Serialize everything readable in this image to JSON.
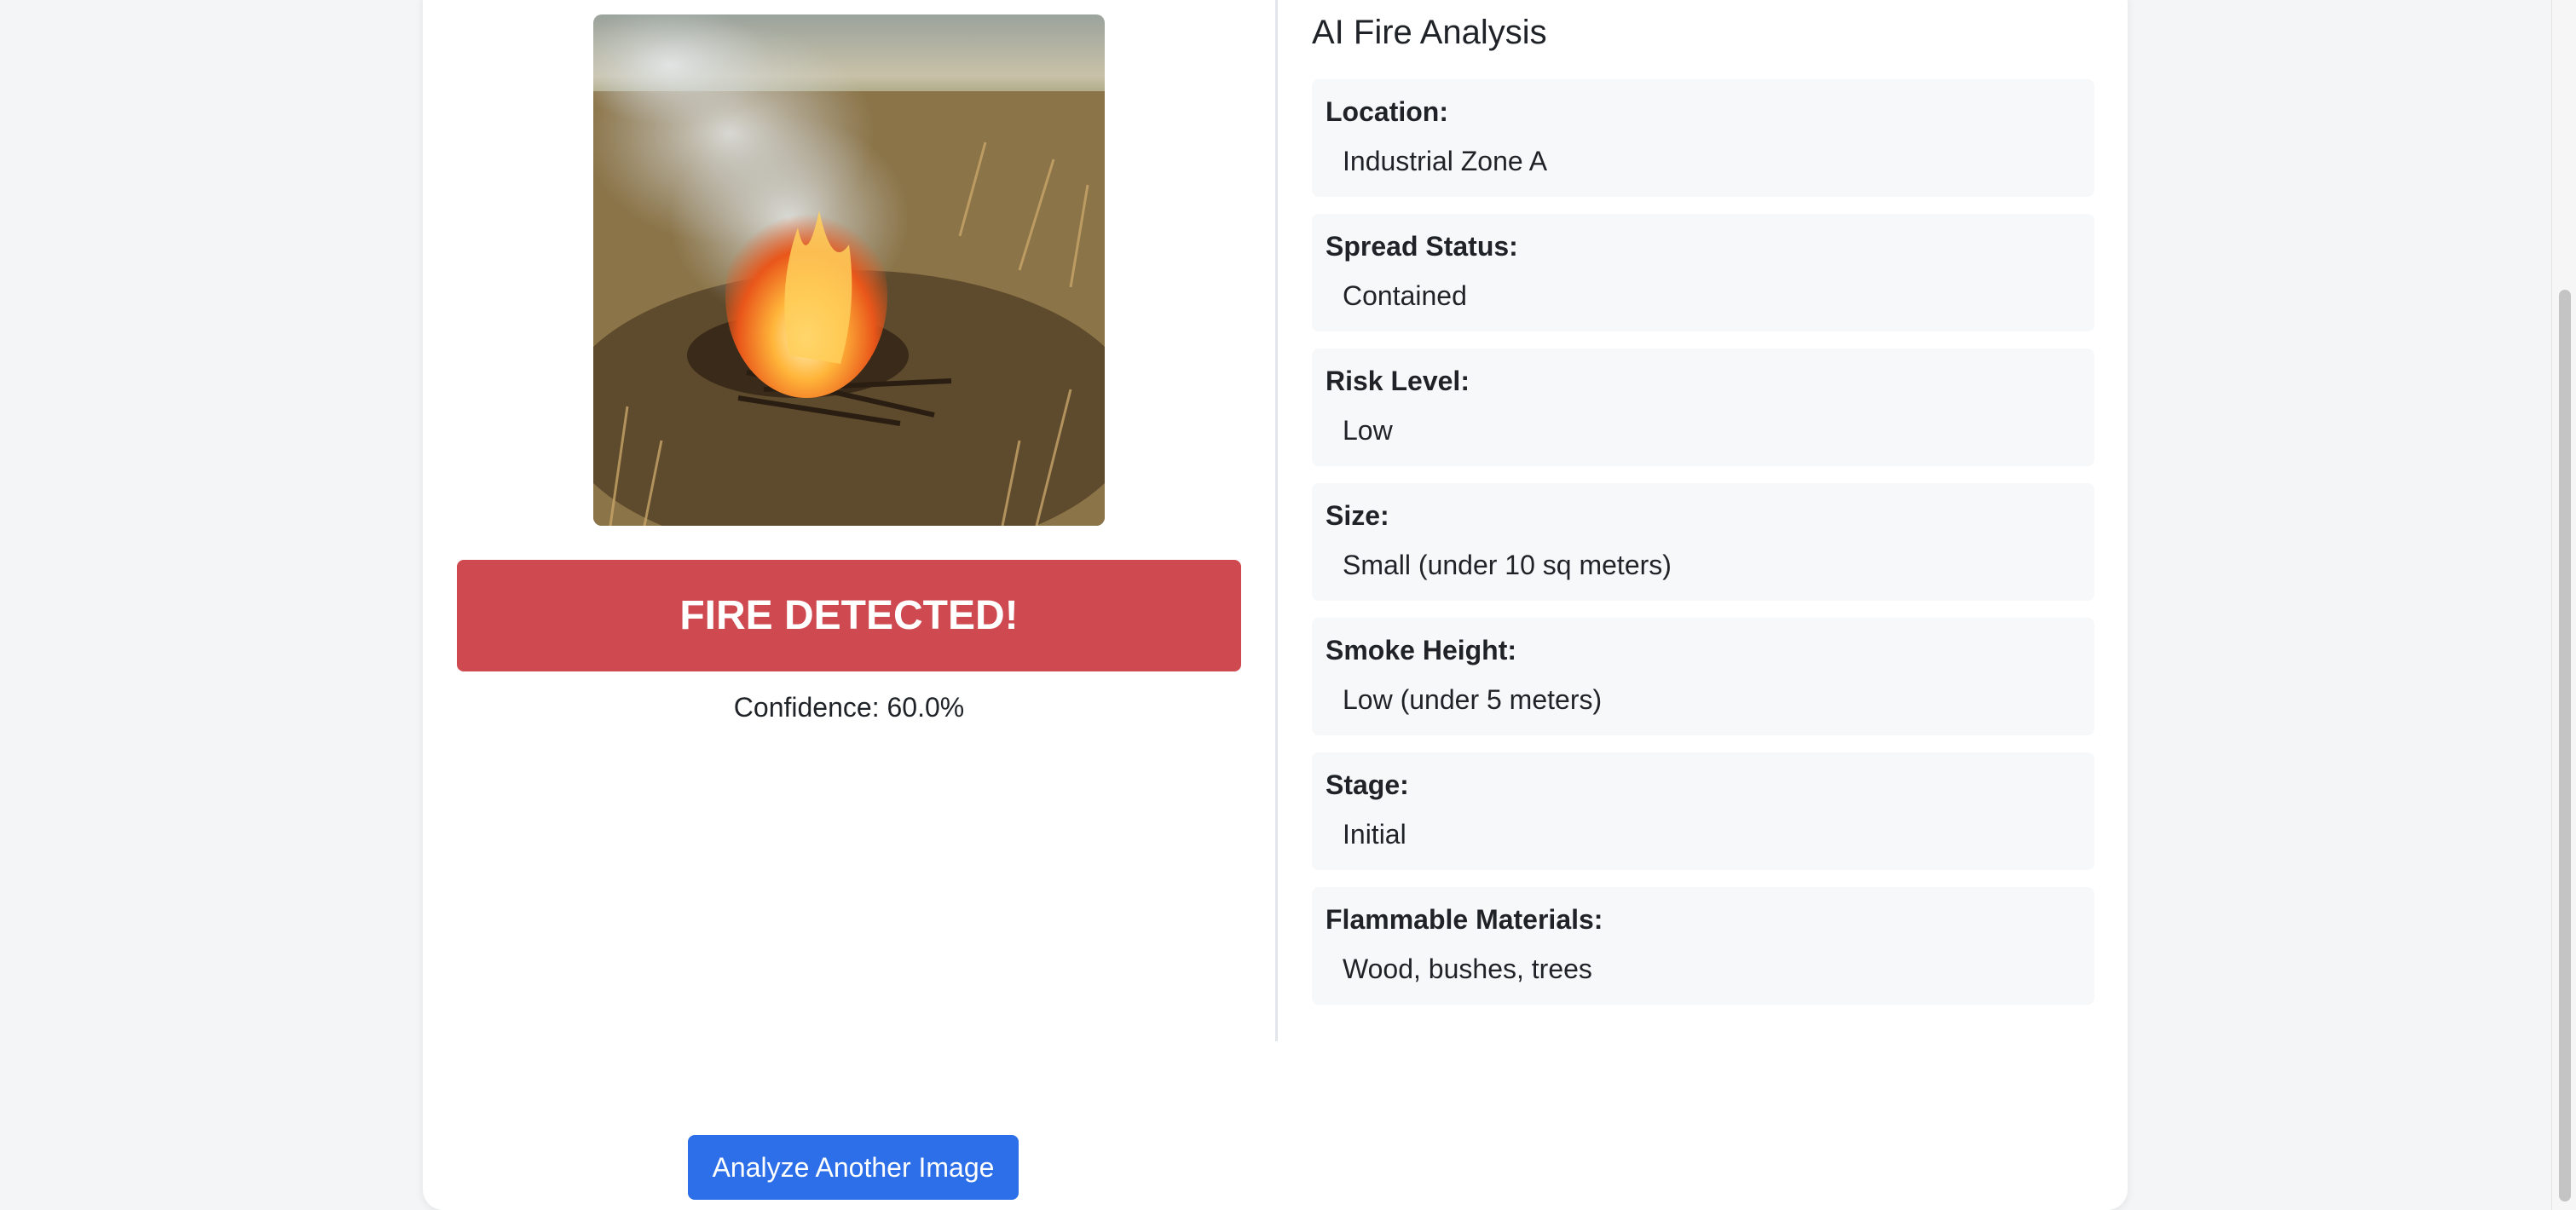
{
  "analysis": {
    "title": "AI Fire Analysis",
    "fields": [
      {
        "label": "Location:",
        "value": "Industrial Zone A"
      },
      {
        "label": "Spread Status:",
        "value": "Contained"
      },
      {
        "label": "Risk Level:",
        "value": "Low"
      },
      {
        "label": "Size:",
        "value": "Small (under 10 sq meters)"
      },
      {
        "label": "Smoke Height:",
        "value": "Low (under 5 meters)"
      },
      {
        "label": "Stage:",
        "value": "Initial"
      },
      {
        "label": "Flammable Materials:",
        "value": "Wood, bushes, trees"
      }
    ]
  },
  "detection": {
    "banner": "FIRE DETECTED!",
    "confidence": "Confidence: 60.0%",
    "image_subject": "campfire in dry grass field"
  },
  "actions": {
    "analyze_another": "Analyze Another Image"
  },
  "colors": {
    "alert": "#cf4a50",
    "primary": "#2c6fe8",
    "field_bg": "#f7f8fa"
  }
}
